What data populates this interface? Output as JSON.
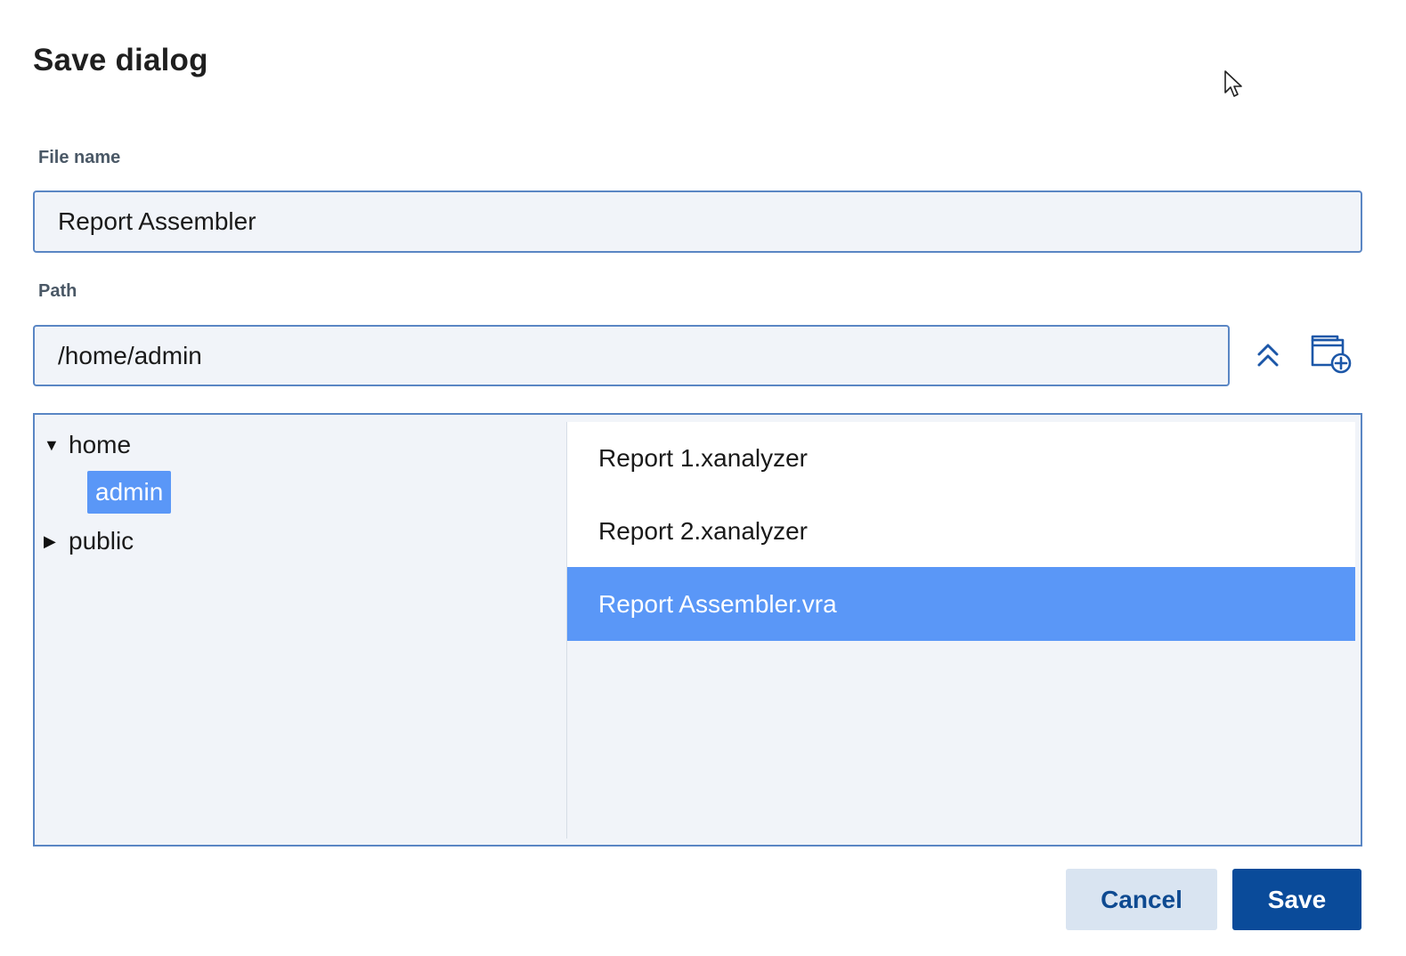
{
  "dialog": {
    "title": "Save dialog"
  },
  "file_name": {
    "label": "File name",
    "value": "Report Assembler"
  },
  "path": {
    "label": "Path",
    "value": "/home/admin"
  },
  "tree": {
    "nodes": [
      {
        "label": "home",
        "expanded": true,
        "children": [
          {
            "label": "admin",
            "selected": true
          }
        ]
      },
      {
        "label": "public",
        "expanded": false
      }
    ]
  },
  "files": [
    {
      "name": "Report 1.xanalyzer",
      "selected": false
    },
    {
      "name": "Report 2.xanalyzer",
      "selected": false
    },
    {
      "name": "Report Assembler.vra",
      "selected": true
    }
  ],
  "buttons": {
    "cancel": "Cancel",
    "save": "Save"
  },
  "icons": {
    "up": "double-chevron-up-icon",
    "new_folder": "folder-add-icon",
    "cursor": "mouse-pointer-icon",
    "expanded": "triangle-down-icon",
    "collapsed": "triangle-right-icon"
  },
  "colors": {
    "accent": "#5a97f7",
    "primary_button": "#0a4b9a",
    "secondary_button": "#d9e4f1",
    "input_border": "#5a86c4",
    "input_bg": "#f1f4f9"
  }
}
